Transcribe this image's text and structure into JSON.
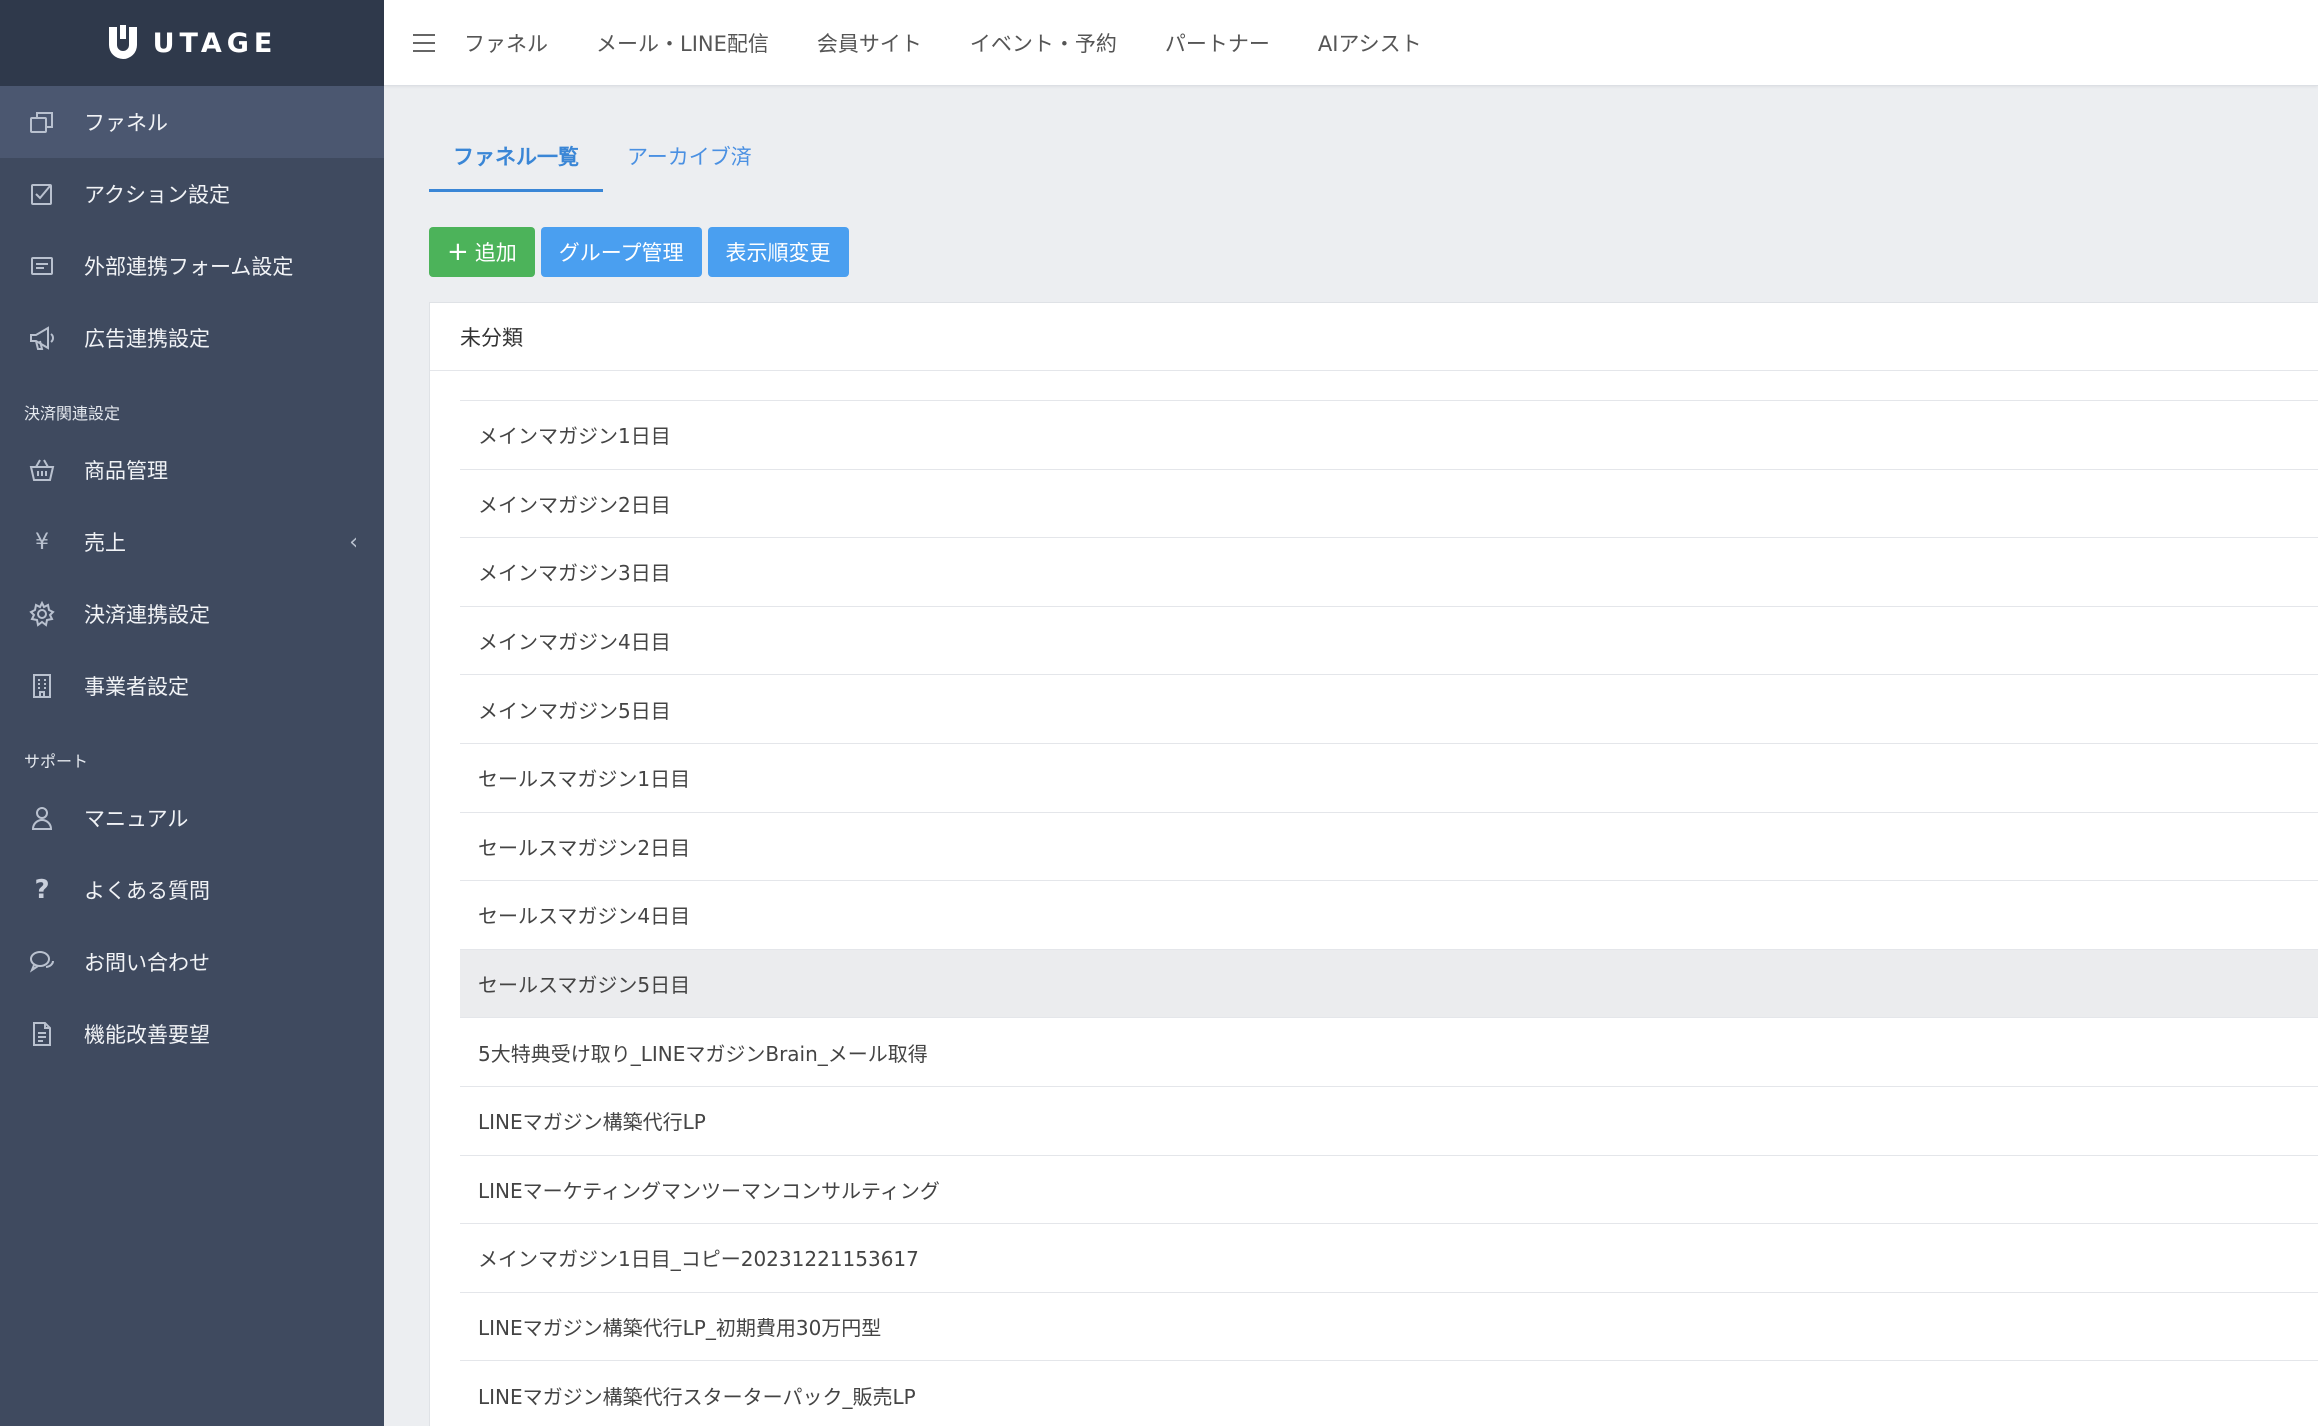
{
  "brand": {
    "name": "UTAGE"
  },
  "sidebar": {
    "main_items": [
      {
        "label": "ファネル",
        "icon": "funnel-copy-icon",
        "active": true
      },
      {
        "label": "アクション設定",
        "icon": "checkbox-icon"
      },
      {
        "label": "外部連携フォーム設定",
        "icon": "form-icon"
      },
      {
        "label": "広告連携設定",
        "icon": "megaphone-icon"
      }
    ],
    "payment_section": "決済関連設定",
    "payment_items": [
      {
        "label": "商品管理",
        "icon": "basket-icon"
      },
      {
        "label": "売上",
        "icon": "yen-icon"
      },
      {
        "label": "決済連携設定",
        "icon": "gear-icon"
      },
      {
        "label": "事業者設定",
        "icon": "building-icon"
      }
    ],
    "support_section": "サポート",
    "support_items": [
      {
        "label": "マニュアル",
        "icon": "user-icon"
      },
      {
        "label": "よくある質問",
        "icon": "question-icon"
      },
      {
        "label": "お問い合わせ",
        "icon": "chat-icon"
      },
      {
        "label": "機能改善要望",
        "icon": "document-icon"
      }
    ]
  },
  "topbar": {
    "links": [
      "ファネル",
      "メール・LINE配信",
      "会員サイト",
      "イベント・予約",
      "パートナー",
      "AIアシスト"
    ]
  },
  "tabs": [
    {
      "label": "ファネル一覧",
      "active": true
    },
    {
      "label": "アーカイブ済",
      "active": false
    }
  ],
  "toolbar": {
    "add_label": "追加",
    "group_label": "グループ管理",
    "order_label": "表示順変更"
  },
  "card": {
    "title": "未分類",
    "rows": [
      "メインマガジン1日目",
      "メインマガジン2日目",
      "メインマガジン3日目",
      "メインマガジン4日目",
      "メインマガジン5日目",
      "セールスマガジン1日目",
      "セールスマガジン2日目",
      "セールスマガジン4日目",
      "セールスマガジン5日目",
      "5大特典受け取り_LINEマガジンBrain_メール取得",
      "LINEマガジン構築代行LP",
      "LINEマーケティングマンツーマンコンサルティング",
      "メインマガジン1日目_コピー20231221153617",
      "LINEマガジン構築代行LP_初期費用30万円型",
      "LINEマガジン構築代行スターターパック_販売LP"
    ]
  },
  "colors": {
    "sidebar_bg": "#3f4a5f",
    "brand_bg": "#2f394b",
    "accent_blue": "#4a9ff0",
    "accent_green": "#4cb35a"
  }
}
